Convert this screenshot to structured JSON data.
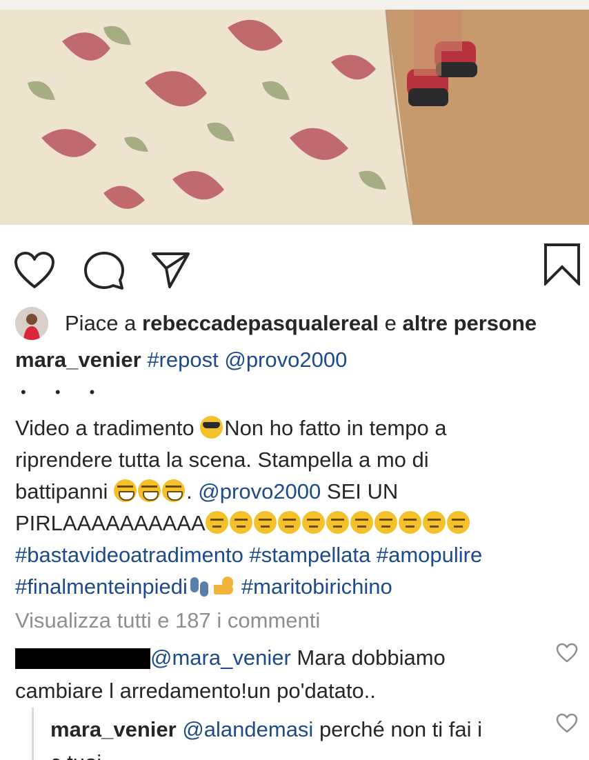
{
  "media": {
    "description_icon": "photo-media"
  },
  "actions": {
    "like_icon": "heart-icon",
    "comment_icon": "comment-icon",
    "share_icon": "send-icon",
    "save_icon": "bookmark-icon"
  },
  "likes": {
    "prefix": "Piace a",
    "user": "rebeccadepasqualereal",
    "connector": "e",
    "others": "altre persone"
  },
  "caption": {
    "username": "mara_venier",
    "hashtag": "#repost",
    "mention": "@provo2000",
    "more_dots": "• • •",
    "line1_a": "Video a tradimento ",
    "line1_b": "Non ho fatto in tempo a",
    "line2": "riprendere tutta la scena. Stampella a mo di",
    "line3_a": "battipanni ",
    "line3_b": ". ",
    "line3_mention": "@provo2000",
    "line3_c": " SEI UN",
    "line4": "PIRLAAAAAAAAAA",
    "line5_tags": "#bastavideoatradimento #stampellata #amopulire",
    "line6_tag1": "#finalmenteinpiedi",
    "line6_tag2": "#maritobirichino"
  },
  "comments": {
    "view_all": "Visualizza tutti e 187 i commenti",
    "c1_mention": "@mara_venier",
    "c1_text_a": " Mara dobbiamo",
    "c1_text_b": "cambiare l arredamento!un po'datato..",
    "reply_user": "mara_venier",
    "reply_mention": "@alandemasi",
    "reply_text": " perché non ti fai i",
    "reply_text2": "c      tuoi"
  }
}
